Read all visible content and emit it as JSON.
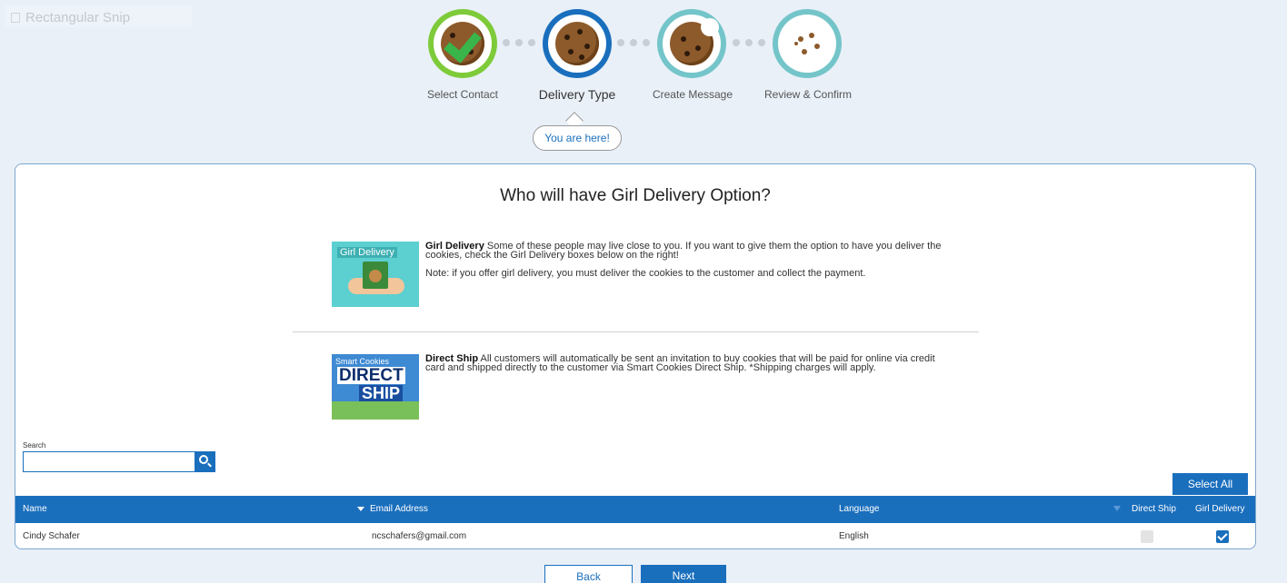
{
  "overlay": {
    "snip_label": "Rectangular Snip"
  },
  "stepper": {
    "steps": [
      {
        "label": "Select Contact",
        "state": "complete"
      },
      {
        "label": "Delivery Type",
        "state": "active"
      },
      {
        "label": "Create Message",
        "state": "pending"
      },
      {
        "label": "Review & Confirm",
        "state": "pending"
      }
    ],
    "you_are_here": "You are here!"
  },
  "card": {
    "title": "Who will have Girl Delivery Option?",
    "girl_delivery": {
      "image_text": "Girl Delivery",
      "heading": "Girl Delivery",
      "text": " Some of these people may live close to you. If you want to give them the option to have you deliver the cookies, check the Girl Delivery boxes below on the right!",
      "note": "Note: if you offer girl delivery, you must deliver the cookies to the customer and collect the payment."
    },
    "direct_ship": {
      "image_text_top": "Smart Cookies",
      "image_text_direct": "DIRECT",
      "image_text_ship": "SHIP",
      "heading": "Direct Ship",
      "text": " All customers will automatically be sent an invitation to buy cookies that will be paid for online via credit card and shipped directly to the customer via Smart Cookies Direct Ship. *Shipping charges will apply."
    },
    "search": {
      "label": "Search",
      "value": "",
      "placeholder": ""
    },
    "select_all_label": "Select All",
    "table": {
      "columns": [
        "Name",
        "Email Address",
        "Language",
        "Direct Ship",
        "Girl Delivery"
      ],
      "rows": [
        {
          "name": "Cindy Schafer",
          "email": "ncschafers@gmail.com",
          "language": "English",
          "direct_ship": false,
          "girl_delivery": true
        }
      ]
    }
  },
  "footer": {
    "back_label": "Back",
    "next_label": "Next"
  },
  "colors": {
    "primary": "#1a6fbd",
    "step_complete": "#7ecb3a",
    "step_pending": "#74c5c9"
  }
}
